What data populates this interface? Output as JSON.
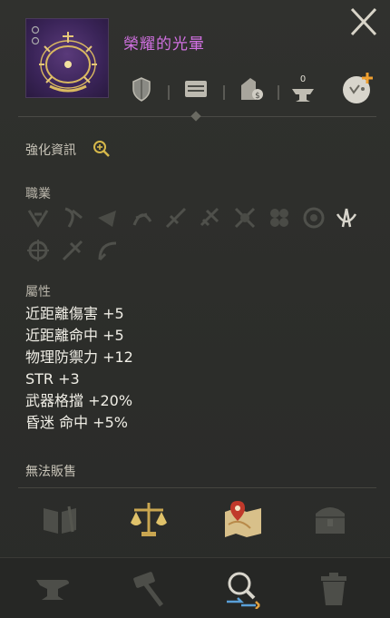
{
  "item": {
    "name": "榮耀的光暈",
    "icon": "radiant-halo-crown-icon"
  },
  "header_icons": [
    "shield-icon",
    "card-icon",
    "bag-hand-icon",
    "anvil-zero-icon",
    "chat-add-icon"
  ],
  "anvil_count": "0",
  "enhance": {
    "label": "強化資訊",
    "icon": "zoom-in-icon"
  },
  "classes": {
    "title": "職業",
    "icons": [
      "class-1-icon",
      "class-2-icon",
      "class-3-icon",
      "class-4-icon",
      "class-5-icon",
      "class-6-icon",
      "class-7-icon",
      "class-8-icon",
      "class-9-icon",
      "class-10-icon",
      "class-11-icon",
      "class-12-icon",
      "class-13-icon"
    ],
    "active_index": 10
  },
  "attributes": {
    "title": "屬性",
    "lines": [
      "近距離傷害 +5",
      "近距離命中 +5",
      "物理防禦力 +12",
      "STR +3",
      "武器格擋 +20%",
      "昏迷 命中 +5%"
    ]
  },
  "cannot_sell": "無法販售",
  "actions": [
    "book-icon",
    "scales-icon",
    "map-icon",
    "chest-icon"
  ],
  "bottom": [
    "anvil-icon",
    "hammer-icon",
    "magnify-swap-icon",
    "trash-icon"
  ],
  "colors": {
    "item_name": "#d070e0",
    "background": "#2b2c2a",
    "gold": "#c9a650"
  }
}
